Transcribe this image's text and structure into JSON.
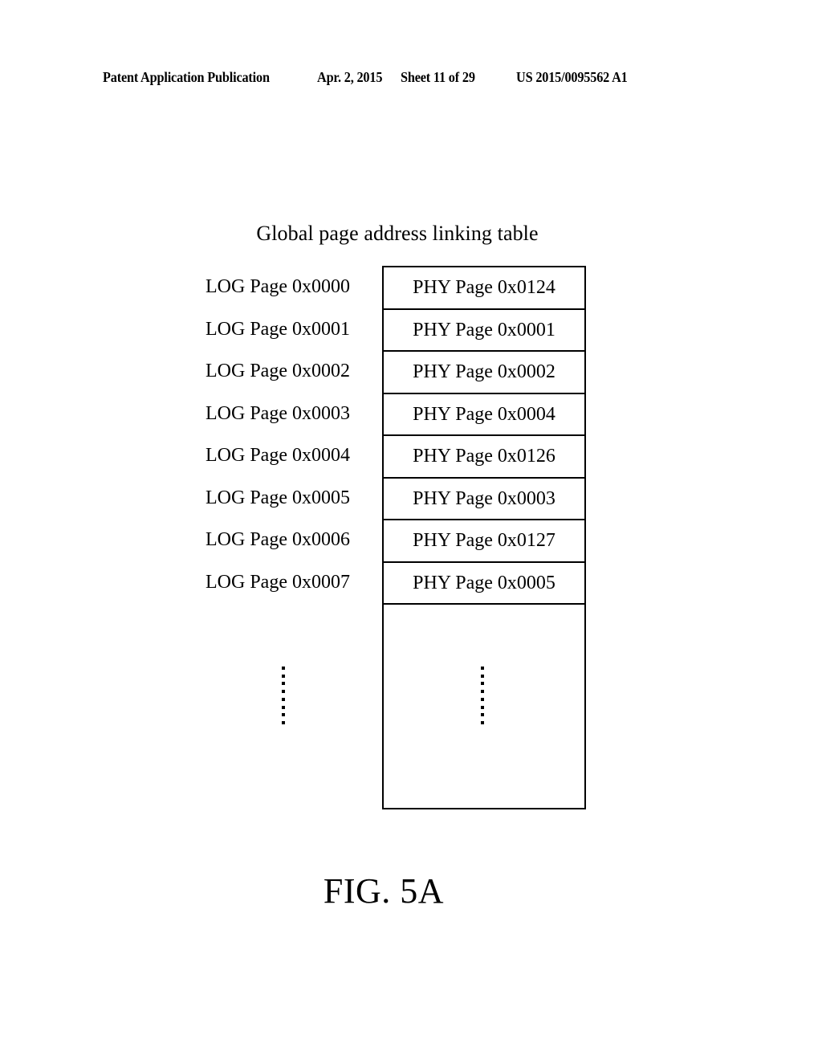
{
  "header": {
    "publication": "Patent Application Publication",
    "date": "Apr. 2, 2015",
    "sheet": "Sheet 11 of 29",
    "number": "US 2015/0095562 A1"
  },
  "figure": {
    "title": "Global page address linking table",
    "caption": "FIG. 5A",
    "ellipsis_dot_count": 8
  },
  "table": {
    "logical_column_label": "LOG Page",
    "physical_column_label": "PHY Page",
    "rows": [
      {
        "logical": "LOG Page 0x0000",
        "physical": "PHY Page 0x0124"
      },
      {
        "logical": "LOG Page 0x0001",
        "physical": "PHY Page 0x0001"
      },
      {
        "logical": "LOG Page 0x0002",
        "physical": "PHY Page 0x0002"
      },
      {
        "logical": "LOG Page 0x0003",
        "physical": "PHY Page 0x0004"
      },
      {
        "logical": "LOG Page 0x0004",
        "physical": "PHY Page 0x0126"
      },
      {
        "logical": "LOG Page 0x0005",
        "physical": "PHY Page 0x0003"
      },
      {
        "logical": "LOG Page 0x0006",
        "physical": "PHY Page 0x0127"
      },
      {
        "logical": "LOG Page 0x0007",
        "physical": "PHY Page 0x0005"
      }
    ]
  },
  "colors": {
    "ink": "#000000",
    "paper": "#ffffff"
  }
}
